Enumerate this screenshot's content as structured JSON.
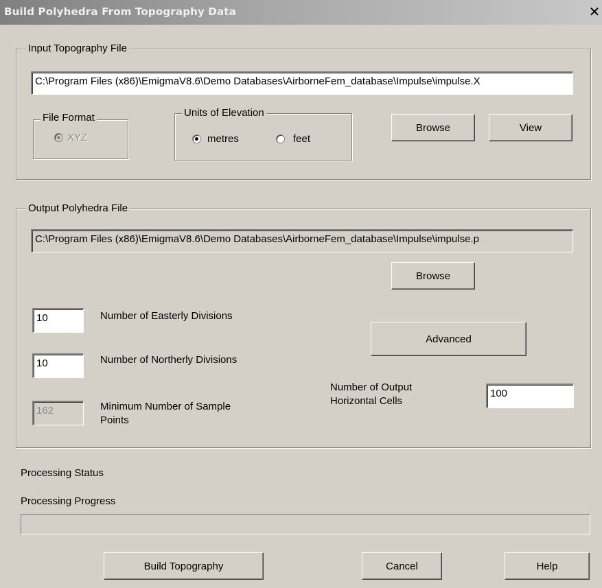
{
  "window": {
    "title": "Build Polyhedra From Topography Data",
    "close_glyph": "✕"
  },
  "input_group": {
    "legend": "Input Topography File",
    "file_path": "C:\\Program Files (x86)\\EmigmaV8.6\\Demo Databases\\AirborneFem_database\\Impulse\\impulse.X",
    "file_format": {
      "legend": "File Format",
      "option_label": "XYZ",
      "selected": true,
      "disabled": true
    },
    "units": {
      "legend": "Units of Elevation",
      "options": [
        {
          "label": "metres",
          "selected": true
        },
        {
          "label": "feet",
          "selected": false
        }
      ]
    },
    "browse_label": "Browse",
    "view_label": "View"
  },
  "output_group": {
    "legend": "Output Polyhedra File",
    "file_path": "C:\\Program Files (x86)\\EmigmaV8.6\\Demo Databases\\AirborneFem_database\\Impulse\\impulse.p",
    "browse_label": "Browse",
    "easterly": {
      "value": "10",
      "label": "Number of Easterly Divisions"
    },
    "northerly": {
      "value": "10",
      "label": "Number of Northerly Divisions"
    },
    "min_samples": {
      "value": "162",
      "label_line1": "Minimum Number of Sample",
      "label_line2": "Points"
    },
    "advanced_label": "Advanced",
    "horizontal_cells": {
      "label_line1": "Number of Output",
      "label_line2": "Horizontal Cells",
      "value": "100"
    }
  },
  "status": {
    "processing_status_label": "Processing Status",
    "processing_progress_label": "Processing Progress",
    "progress_fraction": 0
  },
  "footer": {
    "build_label": "Build Topography",
    "cancel_label": "Cancel",
    "help_label": "Help"
  },
  "colors": {
    "dialog_bg": "#d4d0c8",
    "title_gradient_start": "#808080",
    "title_gradient_end": "#c8c8c8",
    "disabled_text": "#8c8c8c"
  }
}
